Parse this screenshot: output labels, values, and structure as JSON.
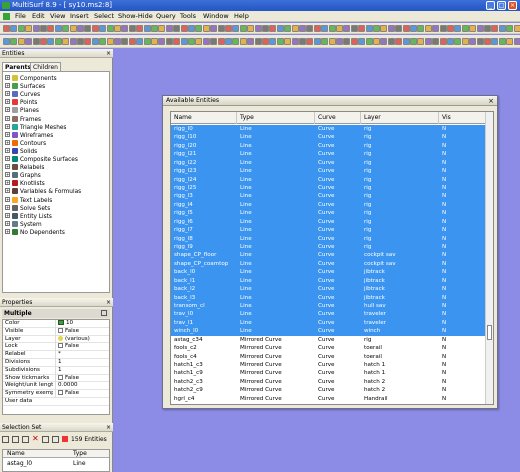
{
  "window": {
    "title": "MultiSurf 8.9 - [ sy10.ms2:8]"
  },
  "menu": [
    "File",
    "Edit",
    "View",
    "Insert",
    "Select",
    "Show-Hide",
    "Query",
    "Tools",
    "Window",
    "Help"
  ],
  "entities_panel": {
    "title": "Entities",
    "tabs": [
      "Parents",
      "Children"
    ],
    "tree": [
      "Components",
      "Surfaces",
      "Curves",
      "Points",
      "Planes",
      "Frames",
      "Triangle Meshes",
      "Wireframes",
      "Contours",
      "Solids",
      "Composite Surfaces",
      "Relabels",
      "Graphs",
      "Knotlists",
      "Variables & Formulas",
      "Text Labels",
      "Solve Sets",
      "Entity Lists",
      "System",
      "No Dependents"
    ],
    "icon_colors": [
      "#d4c23a",
      "#43a047",
      "#5c6bc0",
      "#e53935",
      "#9e9e9e",
      "#8d6e63",
      "#26a69a",
      "#7e57c2",
      "#ef6c00",
      "#3949ab",
      "#00897b",
      "#6d4c41",
      "#546e7a",
      "#b71c1c",
      "#5d4037",
      "#f9a825",
      "#616161",
      "#455a64",
      "#607d8b",
      "#2e7d32"
    ]
  },
  "properties": {
    "title": "Properties",
    "header": "Multiple",
    "rows": [
      {
        "key": "Color",
        "value": "10",
        "swatch": "#21b321"
      },
      {
        "key": "Visible",
        "value": "False",
        "check": true
      },
      {
        "key": "Layer",
        "value": "(various)"
      },
      {
        "key": "Lock",
        "value": "False",
        "check": true
      },
      {
        "key": "Relabel",
        "value": "*"
      },
      {
        "key": "Divisions",
        "value": "1"
      },
      {
        "key": "Subdivisions",
        "value": "1"
      },
      {
        "key": "Show tickmarks",
        "value": "False",
        "check": true
      },
      {
        "key": "Weight/unit length",
        "value": "0.0000"
      },
      {
        "key": "Symmetry exempt",
        "value": "False",
        "check": true
      },
      {
        "key": "User data",
        "value": ""
      }
    ]
  },
  "selection_set": {
    "title": "Selection Set",
    "count_label": "159 Entities",
    "columns": [
      "Name",
      "Type"
    ],
    "rows": [
      {
        "name": "astag_l0",
        "type": "Line"
      }
    ]
  },
  "dialog": {
    "title": "Available Entities",
    "columns": [
      "Name",
      "Type",
      "Curve",
      "Layer",
      "Vis"
    ],
    "rows": [
      [
        "rigg_l0",
        "Line",
        "Curve",
        "rig",
        "N",
        true
      ],
      [
        "rigg_l10",
        "Line",
        "Curve",
        "rig",
        "N",
        true
      ],
      [
        "rigg_l20",
        "Line",
        "Curve",
        "rig",
        "N",
        true
      ],
      [
        "rigg_l21",
        "Line",
        "Curve",
        "rig",
        "N",
        true
      ],
      [
        "rigg_l22",
        "Line",
        "Curve",
        "rig",
        "N",
        true
      ],
      [
        "rigg_l23",
        "Line",
        "Curve",
        "rig",
        "N",
        true
      ],
      [
        "rigg_l24",
        "Line",
        "Curve",
        "rig",
        "N",
        true
      ],
      [
        "rigg_l25",
        "Line",
        "Curve",
        "rig",
        "N",
        true
      ],
      [
        "rigg_l3",
        "Line",
        "Curve",
        "rig",
        "N",
        true
      ],
      [
        "rigg_l4",
        "Line",
        "Curve",
        "rig",
        "N",
        true
      ],
      [
        "rigg_l5",
        "Line",
        "Curve",
        "rig",
        "N",
        true
      ],
      [
        "rigg_l6",
        "Line",
        "Curve",
        "rig",
        "N",
        true
      ],
      [
        "rigg_l7",
        "Line",
        "Curve",
        "rig",
        "N",
        true
      ],
      [
        "rigg_l8",
        "Line",
        "Curve",
        "rig",
        "N",
        true
      ],
      [
        "rigg_l9",
        "Line",
        "Curve",
        "rig",
        "N",
        true
      ],
      [
        "shape_CP_floor",
        "Line",
        "Curve",
        "cockpit sav",
        "N",
        true
      ],
      [
        "shape_CP_coamtop",
        "Line",
        "Curve",
        "cockpit sav",
        "N",
        true
      ],
      [
        "back_l0",
        "Line",
        "Curve",
        "jibtrack",
        "N",
        true
      ],
      [
        "back_l1",
        "Line",
        "Curve",
        "jibtrack",
        "N",
        true
      ],
      [
        "back_l2",
        "Line",
        "Curve",
        "jibtrack",
        "N",
        true
      ],
      [
        "back_l3",
        "Line",
        "Curve",
        "jibtrack",
        "N",
        true
      ],
      [
        "transom_cl",
        "Line",
        "Curve",
        "hull sav",
        "N",
        true
      ],
      [
        "trav_l0",
        "Line",
        "Curve",
        "traveler",
        "N",
        true
      ],
      [
        "trav_l1",
        "Line",
        "Curve",
        "traveler",
        "N",
        true
      ],
      [
        "winch_l0",
        "Line",
        "Curve",
        "winch",
        "N",
        true
      ],
      [
        "astag_c34",
        "Mirrored Curve",
        "Curve",
        "rig",
        "N",
        false
      ],
      [
        "fools_c2",
        "Mirrored Curve",
        "Curve",
        "toerail",
        "N",
        false
      ],
      [
        "fools_c4",
        "Mirrored Curve",
        "Curve",
        "toerail",
        "N",
        false
      ],
      [
        "hatch1_c3",
        "Mirrored Curve",
        "Curve",
        "hatch 1",
        "N",
        false
      ],
      [
        "hatch1_c9",
        "Mirrored Curve",
        "Curve",
        "hatch 1",
        "N",
        false
      ],
      [
        "hatch2_c3",
        "Mirrored Curve",
        "Curve",
        "hatch 2",
        "N",
        false
      ],
      [
        "hatch2_c9",
        "Mirrored Curve",
        "Curve",
        "hatch 2",
        "N",
        false
      ],
      [
        "hgrl_c4",
        "Mirrored Curve",
        "Curve",
        "Handrail",
        "N",
        false
      ]
    ]
  }
}
